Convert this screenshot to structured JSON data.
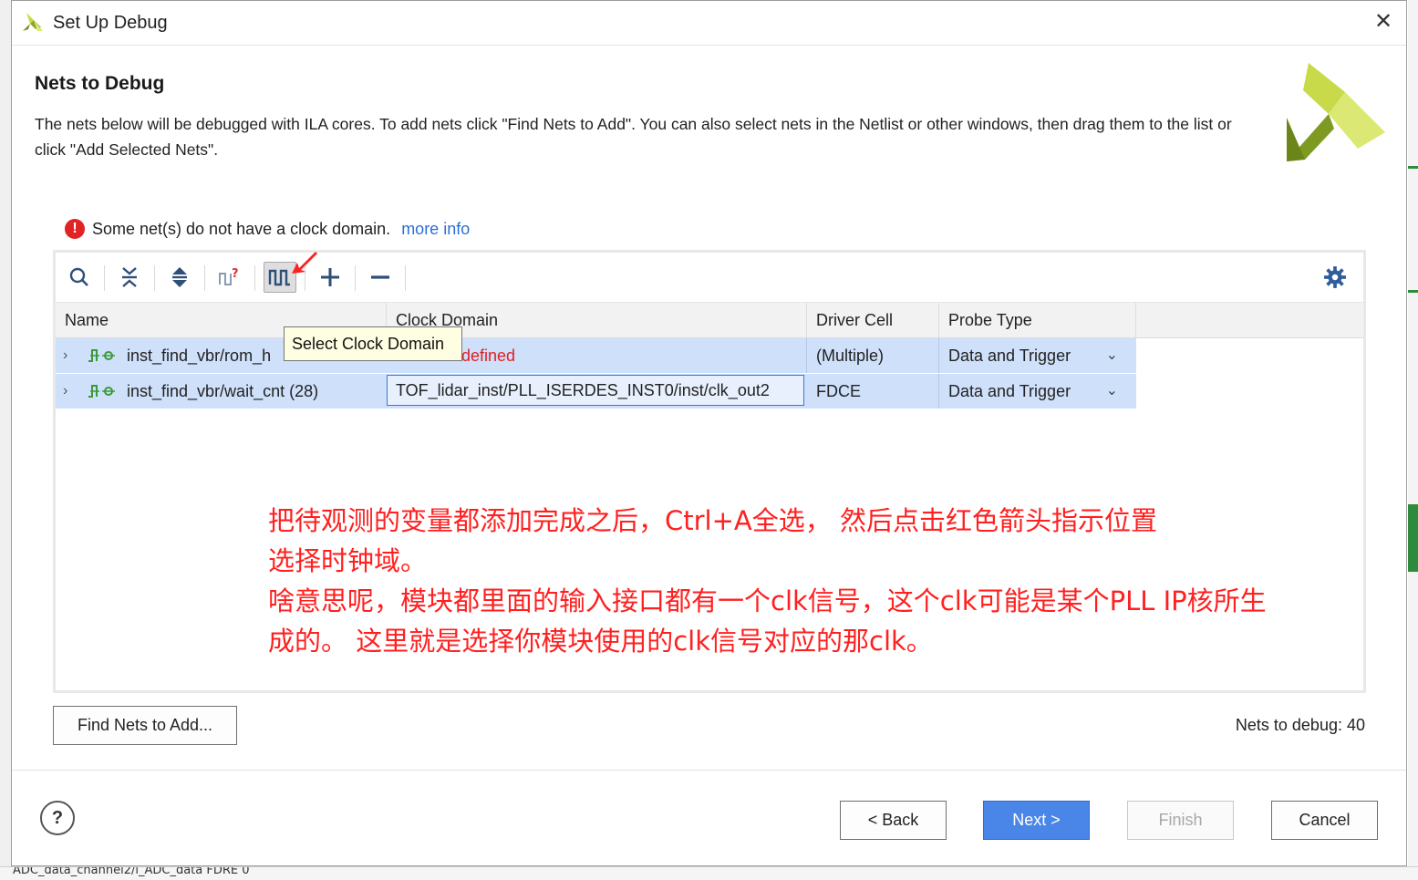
{
  "dialog": {
    "title": "Set Up Debug",
    "close_glyph": "✕"
  },
  "header": {
    "title": "Nets to Debug",
    "description": "The nets below will be debugged with ILA cores. To add nets click \"Find Nets to Add\". You can also select nets in the Netlist or other windows, then drag them to the list or click \"Add Selected Nets\"."
  },
  "warning": {
    "icon": "!",
    "message": "Some net(s) do not have a clock domain.",
    "link": "more info"
  },
  "toolbar": {
    "icons": [
      "search-icon",
      "collapse-all-icon",
      "expand-all-icon",
      "find-clock-icon",
      "select-clock-domain-icon",
      "add-icon",
      "remove-icon",
      "settings-icon"
    ]
  },
  "table": {
    "columns": [
      "Name",
      "Clock Domain",
      "Driver Cell",
      "Probe Type"
    ],
    "rows": [
      {
        "name": "inst_find_vbr/rom_h",
        "clock_domain": "defined",
        "driver_cell": "(Multiple)",
        "probe_type": "Data and Trigger"
      },
      {
        "name": "inst_find_vbr/wait_cnt (28)",
        "clock_domain": "TOF_lidar_inst/PLL_ISERDES_INST0/inst/clk_out2",
        "driver_cell": "FDCE",
        "probe_type": "Data and Trigger"
      }
    ]
  },
  "tooltip": "Select Clock Domain",
  "annotation": [
    "把待观测的变量都添加完成之后，Ctrl+A全选， 然后点击红色箭头指示位置",
    "选择时钟域。",
    "啥意思呢，模块都里面的输入接口都有一个clk信号，这个clk可能是某个PLL IP核所生",
    "成的。 这里就是选择你模块使用的clk信号对应的那clk。"
  ],
  "find_nets_button": "Find Nets to Add...",
  "nets_count": "Nets to debug: 40",
  "footer": {
    "help": "?",
    "back": "< Back",
    "next": "Next >",
    "finish": "Finish",
    "cancel": "Cancel"
  },
  "background": {
    "bottom_text": "ADC_data_channel2/i_ADC_data    FDRE    0"
  },
  "colors": {
    "accent": "#4a86e8",
    "row_selected": "#cfe0fa",
    "warning": "#e02424",
    "annotation": "#ff2020",
    "link": "#2b6fd6"
  }
}
